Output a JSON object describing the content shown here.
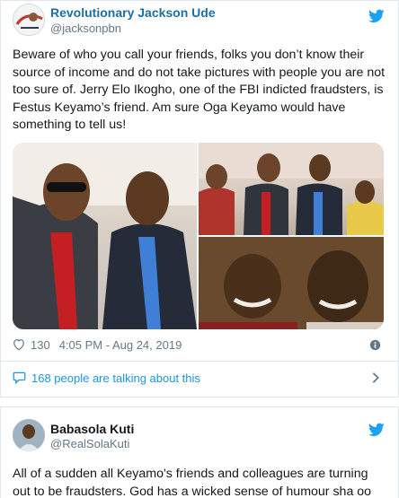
{
  "tweet1": {
    "name": "Revolutionary Jackson Ude",
    "handle": "@jacksonpbn",
    "text": "Beware of who you call your friends, folks you don’t know their source of income and do not take pictures with people you are not too sure of. Jerry Elo Ikogho, one of the FBI indicted fraudsters, is Festus Keyamo’s friend. Am sure Oga Keyamo would have something to tell us!",
    "likes": "130",
    "timestamp": "4:05 PM - Aug 24, 2019",
    "conversation": "168 people are talking about this"
  },
  "tweet2": {
    "name": "Babasola Kuti",
    "handle": "@RealSolaKuti",
    "text": "All of a sudden all Keyamo's friends and colleagues are turning out to be fraudsters. God has a wicked sense of humour sha oo"
  },
  "colors": {
    "link_blue": "#1b95e0",
    "name_blue": "#1c6ea4",
    "muted": "#657786",
    "border": "#e1e8ed"
  },
  "icons": [
    "twitter-bird-icon",
    "heart-icon",
    "info-icon",
    "speech-bubble-icon",
    "chevron-right-icon"
  ]
}
